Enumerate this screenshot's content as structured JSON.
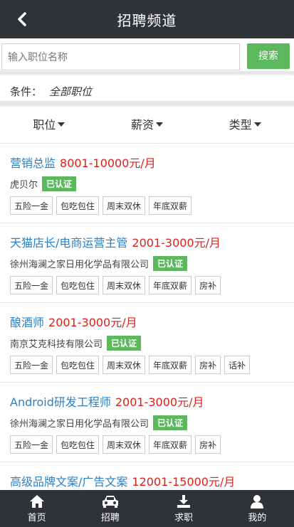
{
  "header": {
    "title": "招聘频道",
    "back_icon": "chevron-left-icon"
  },
  "search": {
    "placeholder": "输入职位名称",
    "button_label": "搜索"
  },
  "condition": {
    "label": "条件：",
    "value": "全部职位"
  },
  "filters": [
    {
      "label": "职位"
    },
    {
      "label": "薪资"
    },
    {
      "label": "类型"
    }
  ],
  "jobs": [
    {
      "title": "营销总监",
      "salary": "8001-10000元/月",
      "company": "虎贝尔",
      "badge": "已认证",
      "tags": [
        "五险一金",
        "包吃包住",
        "周末双休",
        "年底双薪"
      ]
    },
    {
      "title": "天猫店长/电商运营主管",
      "salary": "2001-3000元/月",
      "company": "徐州海澜之家日用化学品有限公司",
      "badge": "已认证",
      "tags": [
        "五险一金",
        "包吃包住",
        "周末双休",
        "年底双薪",
        "房补"
      ]
    },
    {
      "title": "酿酒师",
      "salary": "2001-3000元/月",
      "company": "南京艾克科技有限公司",
      "badge": "已认证",
      "tags": [
        "五险一金",
        "包吃包住",
        "周末双休",
        "年底双薪",
        "房补",
        "话补"
      ]
    },
    {
      "title": "Android研发工程师",
      "salary": "2001-3000元/月",
      "company": "徐州海澜之家日用化学品有限公司",
      "badge": "已认证",
      "tags": [
        "五险一金",
        "包吃包住",
        "周末双休",
        "年底双薪",
        "房补"
      ]
    },
    {
      "title": "高级品牌文案/广告文案",
      "salary": "12001-15000元/月",
      "company": "",
      "badge": "",
      "tags": []
    }
  ],
  "tabbar": [
    {
      "label": "首页",
      "icon": "home-icon"
    },
    {
      "label": "招聘",
      "icon": "car-icon"
    },
    {
      "label": "求职",
      "icon": "download-icon"
    },
    {
      "label": "我的",
      "icon": "user-icon"
    }
  ],
  "colors": {
    "accent": "#5cb85c",
    "title_blue": "#2b80c4",
    "salary_red": "#d9231d",
    "dark_bar": "#2f3236"
  }
}
